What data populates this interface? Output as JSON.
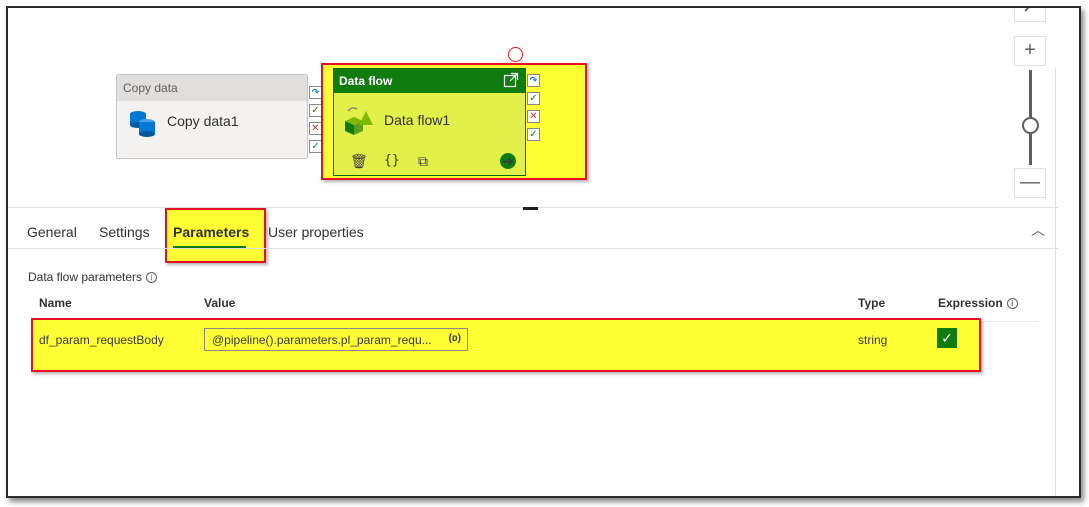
{
  "canvas": {
    "copy_activity": {
      "header": "Copy data",
      "name": "Copy data1"
    },
    "dataflow_activity": {
      "header": "Data flow",
      "name": "Data flow1"
    },
    "zoom": {
      "plus": "+",
      "minus": "—"
    }
  },
  "tabs": [
    {
      "label": "General"
    },
    {
      "label": "Settings"
    },
    {
      "label": "Parameters"
    },
    {
      "label": "User properties"
    }
  ],
  "parameters": {
    "section_title": "Data flow parameters",
    "columns": {
      "name": "Name",
      "value": "Value",
      "type": "Type",
      "expression": "Expression"
    },
    "rows": [
      {
        "name": "df_param_requestBody",
        "value": "@pipeline().parameters.pl_param_requ...",
        "type": "string",
        "expression": true
      }
    ]
  },
  "colors": {
    "accent": "#107c10",
    "highlight": "#ffff33",
    "annotation": "#e81123"
  }
}
